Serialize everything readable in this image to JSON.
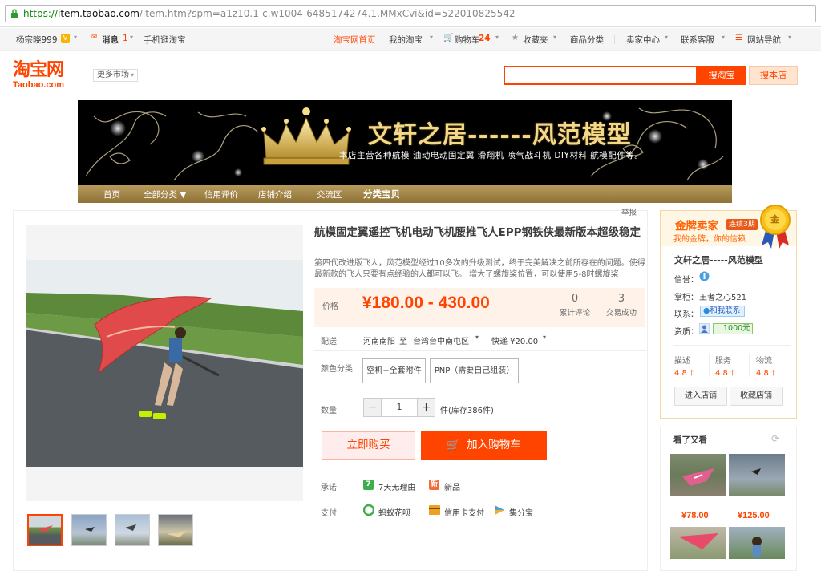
{
  "browser": {
    "url_scheme": "https://",
    "url_host": "item.taobao.com",
    "url_path": "/item.htm?spm=a1z10.1-c.w1004-6485174274.1.MMxCvi&id=522010825542"
  },
  "site_nav": {
    "username": "杨宗晓999",
    "vip_badge": "V",
    "messages_label": "消息",
    "messages_count": "1",
    "mobile_label": "手机逛淘宝",
    "home": "淘宝网首页",
    "my_taobao": "我的淘宝",
    "cart_label": "购物车",
    "cart_count": "24",
    "favorites": "收藏夹",
    "categories": "商品分类",
    "seller_center": "卖家中心",
    "contact_service": "联系客服",
    "site_nav": "网站导航"
  },
  "header": {
    "logo_cn": "淘宝网",
    "logo_en": "Taobao.com",
    "more_markets": "更多市场",
    "search_placeholder": "",
    "search_taobao_btn": "搜淘宝",
    "search_shop_btn": "搜本店"
  },
  "banner": {
    "title": "文轩之居------风范模型",
    "subtitle": "本店主营各种航模 油动电动固定翼 滑翔机 喷气战斗机 DIY材料 航模配件等。",
    "nav": [
      {
        "label": "首页"
      },
      {
        "label": "全部分类 ▼"
      },
      {
        "label": "信用评价"
      },
      {
        "label": "店铺介绍"
      },
      {
        "label": "交流区"
      },
      {
        "label": "分类宝贝"
      }
    ]
  },
  "product": {
    "report_link": "举报",
    "title": "航模固定翼遥控飞机电动飞机腰推飞人EPP钢铁侠最新版本超级稳定",
    "description": "第四代改进版飞人，风范模型经过10多次的升级测试，终于完美解决之前所存在的问题。使得最新款的飞人只要有点经验的人都可以飞。 增大了螺旋桨位置，可以使用5-8时螺旋桨",
    "price_label": "价格",
    "price": "¥180.00 - 430.00",
    "reviews_count": "0",
    "reviews_label": "累计评论",
    "sales_count": "3",
    "sales_label": "交易成功",
    "shipping_label": "配送",
    "ship_from": "河南南阳",
    "ship_to_word": "至",
    "ship_to": "台湾台中南屯区",
    "express": "快递 ¥20.00",
    "color_label": "颜色分类",
    "options": [
      {
        "label": "空机+全套附件"
      },
      {
        "label": "PNP（需要自己组装）"
      }
    ],
    "quantity_label": "数量",
    "quantity": "1",
    "stock_text": "件(库存386件)",
    "buy_now": "立即购买",
    "add_to_cart": "加入购物车",
    "promise_label": "承诺",
    "promise_1": "7天无理由",
    "promise_2": "新品",
    "promise_icon_1": "7",
    "promise_icon_2": "新",
    "payment_label": "支付",
    "pay_1": "蚂蚁花呗",
    "pay_2": "信用卡支付",
    "pay_3": "集分宝"
  },
  "shop": {
    "gold_title": "金牌卖家",
    "gold_years": "连续3期",
    "gold_sub": "我的金牌，你的信赖",
    "medal_char": "金",
    "name": "文轩之居-----风范模型",
    "credit_label": "信誉：",
    "manager_label": "掌柜：",
    "manager_name": "王者之心521",
    "contact_label": "联系：",
    "contact_btn": "和我联系",
    "qual_label": "资质：",
    "deposit": "1000元",
    "dsr": [
      {
        "label": "描述",
        "score": "4.8"
      },
      {
        "label": "服务",
        "score": "4.8"
      },
      {
        "label": "物流",
        "score": "4.8"
      }
    ],
    "enter_shop": "进入店铺",
    "fav_shop": "收藏店铺",
    "see_also_title": "看了又看",
    "recs": [
      {
        "price": "¥78.00"
      },
      {
        "price": "¥125.00"
      }
    ]
  },
  "colors": {
    "brand_orange": "#ff4400",
    "price_bg": "#fff2e8",
    "gold": "#ff6000"
  }
}
